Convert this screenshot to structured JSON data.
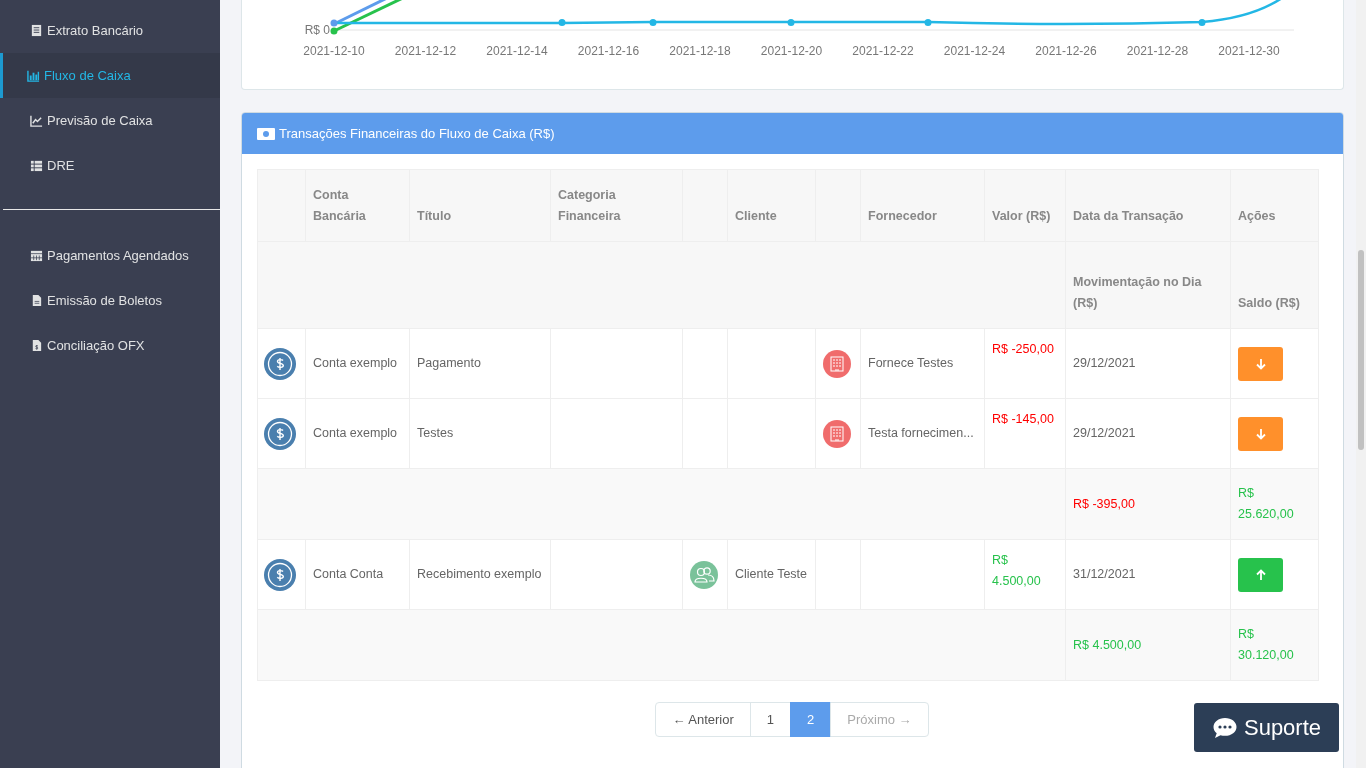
{
  "sidebar": {
    "groups": [
      {
        "items": [
          {
            "label": "Extrato Bancário",
            "selected": false
          },
          {
            "label": "Fluxo de Caixa",
            "selected": true
          },
          {
            "label": "Previsão de Caixa",
            "selected": false
          },
          {
            "label": "DRE",
            "selected": false
          }
        ]
      },
      {
        "items": [
          {
            "label": "Pagamentos Agendados",
            "selected": false
          },
          {
            "label": "Emissão de Boletos",
            "selected": false
          },
          {
            "label": "Conciliação OFX",
            "selected": false
          }
        ]
      }
    ]
  },
  "chart": {
    "y_label": "R$ 0",
    "x_labels": [
      "2021-12-10",
      "2021-12-12",
      "2021-12-14",
      "2021-12-16",
      "2021-12-18",
      "2021-12-20",
      "2021-12-22",
      "2021-12-24",
      "2021-12-26",
      "2021-12-28",
      "2021-12-30"
    ]
  },
  "transactions": {
    "title": "Transações Financeiras do Fluxo de Caixa (R$)",
    "columns": [
      "Conta Bancária",
      "Título",
      "Categoria Financeira",
      "Cliente",
      "Fornecedor",
      "Valor (R$)",
      "Data da Transação",
      "Ações"
    ],
    "subheader": [
      "Movimentação no Dia (R$)",
      "Saldo (R$)"
    ],
    "rows": [
      {
        "kind": "payment",
        "account": "Conta exemplo",
        "title": "Pagamento",
        "supplier": "Fornece Testes",
        "value": "R$ -250,00",
        "date": "29/12/2021"
      },
      {
        "kind": "payment",
        "account": "Conta exemplo",
        "title": "Testes",
        "supplier": "Testa fornecimen...",
        "value": "R$ -145,00",
        "date": "29/12/2021"
      },
      {
        "kind": "summary",
        "movement": {
          "text": "R$ -395,00",
          "color": "#ff0000"
        },
        "balance": {
          "text": "R$ 25.620,00",
          "color": "#27c24c"
        }
      },
      {
        "kind": "receipt",
        "account": "Conta Conta",
        "title": "Recebimento exemplo",
        "client": "Cliente Teste",
        "value": "R$ 4.500,00",
        "date": "31/12/2021"
      },
      {
        "kind": "summary",
        "movement": {
          "text": "R$ 4.500,00",
          "color": "#27c24c"
        },
        "balance": {
          "text": "R$ 30.120,00",
          "color": "#27c24c"
        }
      }
    ],
    "pagination": [
      {
        "label": "← Anterior",
        "selected": false,
        "disabled": false
      },
      {
        "label": "1",
        "selected": false,
        "disabled": false
      },
      {
        "label": "2",
        "selected": true,
        "disabled": false
      },
      {
        "label": "Próximo →",
        "selected": false,
        "disabled": true
      }
    ]
  },
  "support_button": "Suporte"
}
